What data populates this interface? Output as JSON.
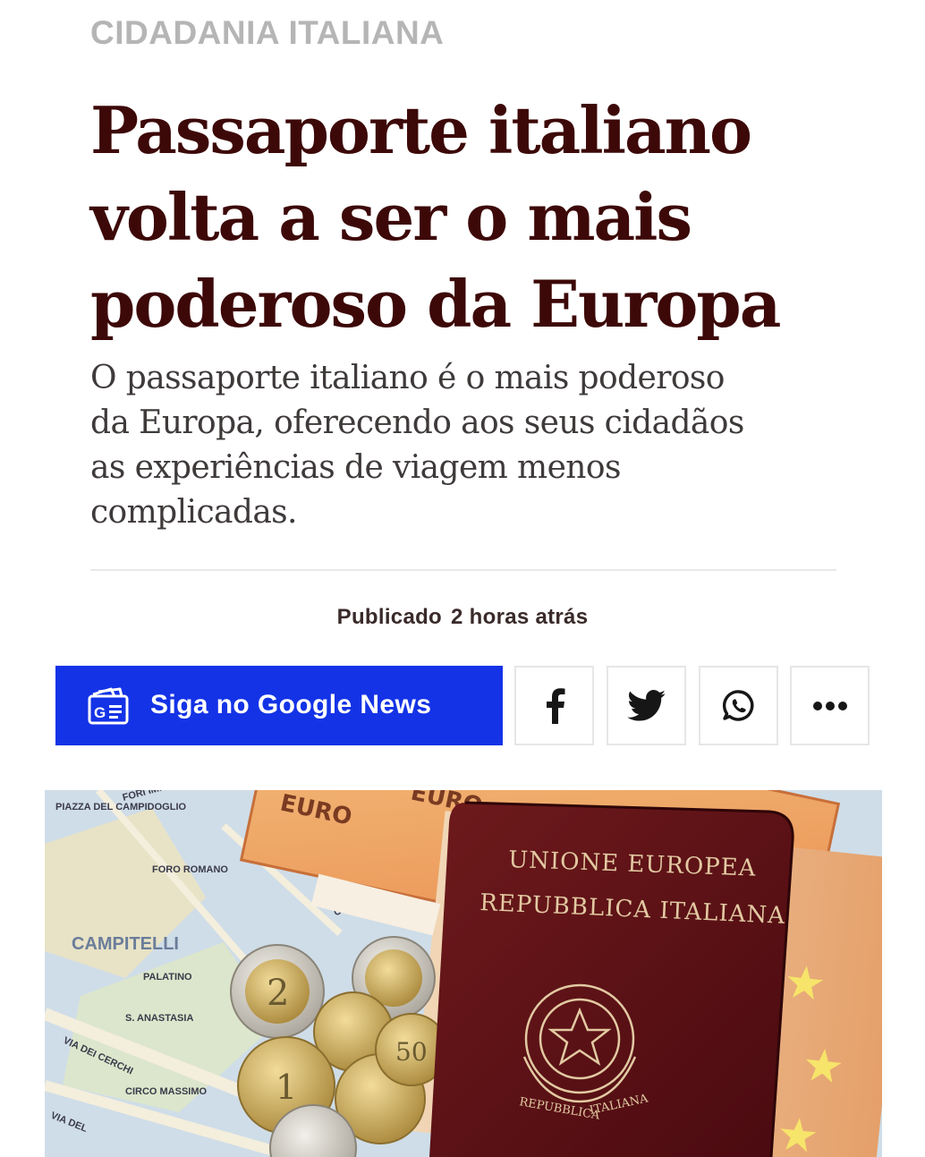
{
  "article": {
    "kicker": "CIDADANIA ITALIANA",
    "headline_lines": [
      "Passaporte italiano",
      "volta a ser o mais",
      "poderoso da Europa"
    ],
    "summary_lines": [
      "O passaporte italiano é o mais poderoso",
      "da Europa, oferecendo aos seus cidadãos",
      "as experiências de viagem menos",
      "complicadas."
    ],
    "published_label": "Publicado",
    "published_time": "2 horas atrás"
  },
  "follow": {
    "label": "Siga no Google News",
    "icon": "google-news-icon",
    "color": "#1433e6"
  },
  "share": {
    "buttons": [
      {
        "name": "facebook",
        "icon": "facebook-icon"
      },
      {
        "name": "twitter",
        "icon": "twitter-icon"
      },
      {
        "name": "whatsapp",
        "icon": "whatsapp-icon"
      },
      {
        "name": "more",
        "icon": "more-icon"
      }
    ]
  },
  "hero": {
    "passport_line1": "UNIONE EUROPEA",
    "passport_line2": "REPUBBLICA ITALIANA",
    "emblem_ribbon_left": "REPUBBLICA",
    "emblem_ribbon_right": "ITALIANA",
    "banknote_text": "EURO",
    "coin_values": [
      "2",
      "1",
      "50"
    ],
    "map_labels": [
      "PIAZZA DEL CAMPIDOGLIO",
      "FORI IMPERIALI",
      "FORO ROMANO",
      "CAMPITELLI",
      "PALATINO",
      "COLOSSEO",
      "VIA DEI CERCHI",
      "CIRCO MASSIMO",
      "VIA DEL",
      "S. ANASTASIA"
    ],
    "colors": {
      "passport": "#5b0f14",
      "passport_gold": "#e2c9a2",
      "map_bg": "#c9d9e6"
    }
  }
}
